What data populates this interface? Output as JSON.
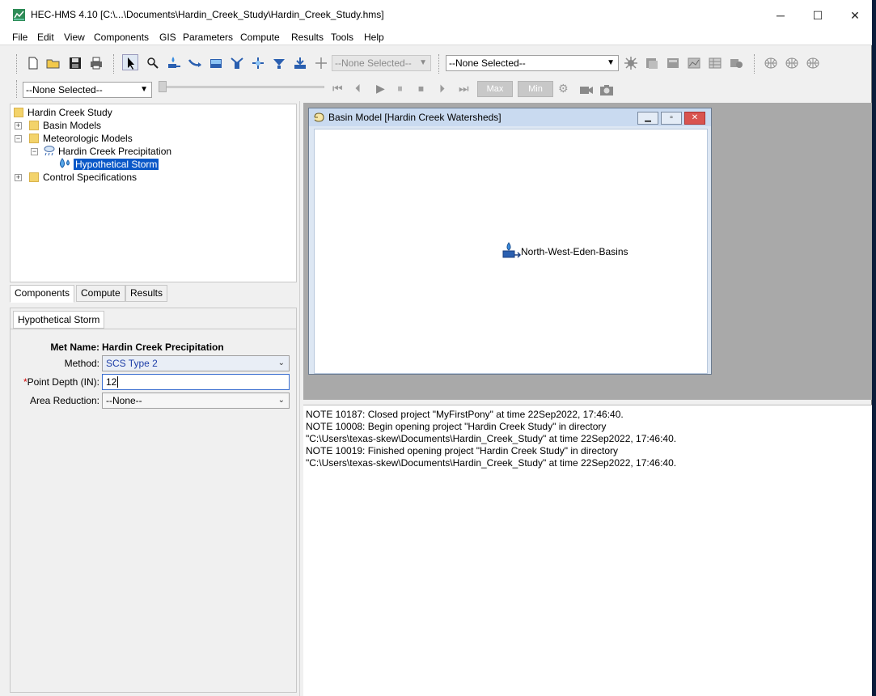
{
  "window": {
    "title": "HEC-HMS 4.10 [C:\\...\\Documents\\Hardin_Creek_Study\\Hardin_Creek_Study.hms]",
    "minimize_glyph": "─",
    "maximize_glyph": "☐",
    "close_glyph": "✕"
  },
  "menu": [
    "File",
    "Edit",
    "View",
    "Components",
    "GIS",
    "Parameters",
    "Compute",
    "Results",
    "Tools",
    "Help"
  ],
  "toolbar": {
    "combo_disabled": "--None Selected--",
    "combo_main": "--None Selected--",
    "combo_lower": "--None Selected--",
    "max_label": "Max",
    "min_label": "Min"
  },
  "tree": {
    "root": "Hardin Creek Study",
    "basin_models": "Basin Models",
    "meteorologic_models": "Meteorologic Models",
    "met_model": "Hardin Creek Precipitation",
    "storm": "Hypothetical Storm",
    "control_specs": "Control Specifications"
  },
  "tabs": [
    "Components",
    "Compute",
    "Results"
  ],
  "properties": {
    "tab": "Hypothetical Storm",
    "met_name_label": "Met Name:",
    "met_name_value": "Hardin Creek Precipitation",
    "method_label": "Method:",
    "method_value": "SCS Type 2",
    "required_marker": "*",
    "point_depth_label": "Point Depth (IN):",
    "point_depth_value": "12",
    "area_reduction_label": "Area Reduction:",
    "area_reduction_value": "--None--"
  },
  "basin_window": {
    "title": "Basin Model [Hardin Creek Watersheds]",
    "element_label": "North-West-Eden-Basins"
  },
  "log": [
    "NOTE 10187:  Closed project \"MyFirstPony\" at time 22Sep2022, 17:46:40.",
    "NOTE 10008:  Begin opening project \"Hardin Creek Study\" in directory",
    "\"C:\\Users\\texas-skew\\Documents\\Hardin_Creek_Study\" at time 22Sep2022, 17:46:40.",
    "NOTE 10019:  Finished opening project \"Hardin Creek Study\" in directory",
    "\"C:\\Users\\texas-skew\\Documents\\Hardin_Creek_Study\" at time 22Sep2022, 17:46:40."
  ]
}
